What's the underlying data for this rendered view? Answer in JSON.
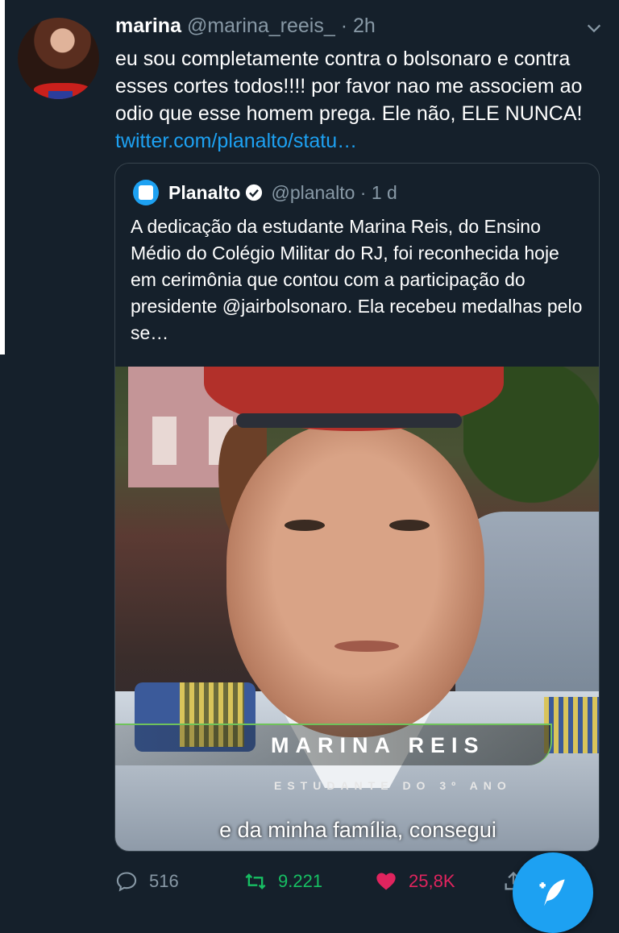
{
  "tweet": {
    "name": "marina",
    "handle": "@marina_reeis_",
    "separator": "·",
    "time": "2h",
    "text": "eu sou completamente contra o bolsonaro e contra esses cortes todos!!!! por favor nao me associem ao odio que esse homem prega. Ele não, ELE NUNCA!",
    "link": "twitter.com/planalto/statu…"
  },
  "quote": {
    "name": "Planalto",
    "handle": "@planalto",
    "separator": "·",
    "time": "1 d",
    "text": "A dedicação da estudante Marina Reis, do Ensino Médio do Colégio Militar do RJ, foi reconhecida hoje em cerimônia que contou com a participação do presidente @jairbolsonaro. Ela recebeu medalhas pelo se…",
    "video": {
      "lower_third_name": "MARINA REIS",
      "lower_third_sub": "ESTUDANTE DO 3º ANO",
      "subtitle": "e da minha família, consegui"
    }
  },
  "actions": {
    "replies": "516",
    "retweets": "9.221",
    "likes": "25,8K"
  },
  "colors": {
    "background": "#15202b",
    "accent": "#1da1f2",
    "retweet": "#17bf63",
    "like": "#e0245e",
    "muted": "#8899a6"
  },
  "icons": [
    "chevron-down-icon",
    "verified-icon",
    "reply-icon",
    "retweet-icon",
    "like-icon",
    "share-icon",
    "compose-icon"
  ]
}
